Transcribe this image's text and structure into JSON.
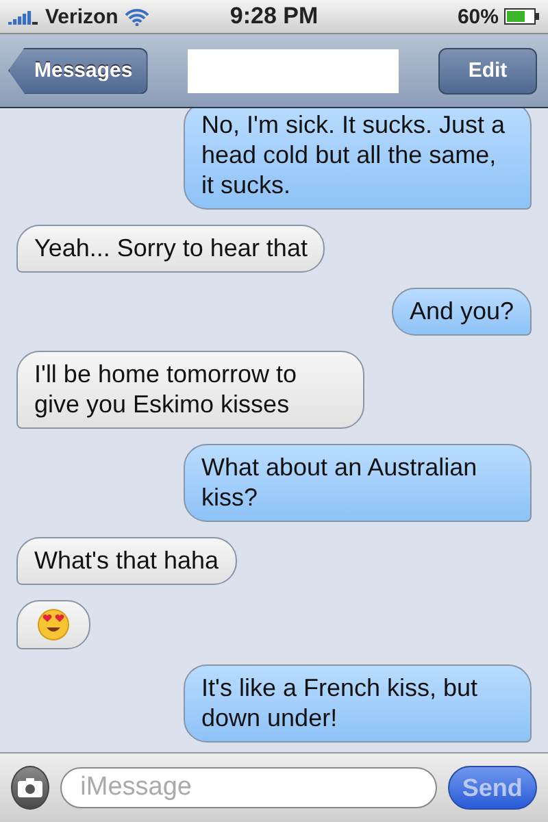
{
  "status_bar": {
    "carrier": "Verizon",
    "time": "9:28 PM",
    "battery": "60%"
  },
  "nav_bar": {
    "back": "Messages",
    "edit": "Edit"
  },
  "messages": [
    {
      "outgoing": true,
      "kind": "text",
      "text": "No, I'm sick. It sucks. Just a head cold but all the same, it sucks."
    },
    {
      "outgoing": false,
      "kind": "text",
      "text": "Yeah... Sorry to hear that"
    },
    {
      "outgoing": true,
      "kind": "text",
      "text": "And you?"
    },
    {
      "outgoing": false,
      "kind": "text",
      "text": "I'll be home tomorrow to give you Eskimo kisses"
    },
    {
      "outgoing": true,
      "kind": "text",
      "text": "What about an Australian kiss?"
    },
    {
      "outgoing": false,
      "kind": "text",
      "text": "What's that haha"
    },
    {
      "outgoing": false,
      "kind": "emoji"
    },
    {
      "outgoing": true,
      "kind": "text",
      "text": "It's like a French kiss, but down under!"
    }
  ],
  "composer": {
    "placeholder": "iMessage",
    "send": "Send"
  }
}
